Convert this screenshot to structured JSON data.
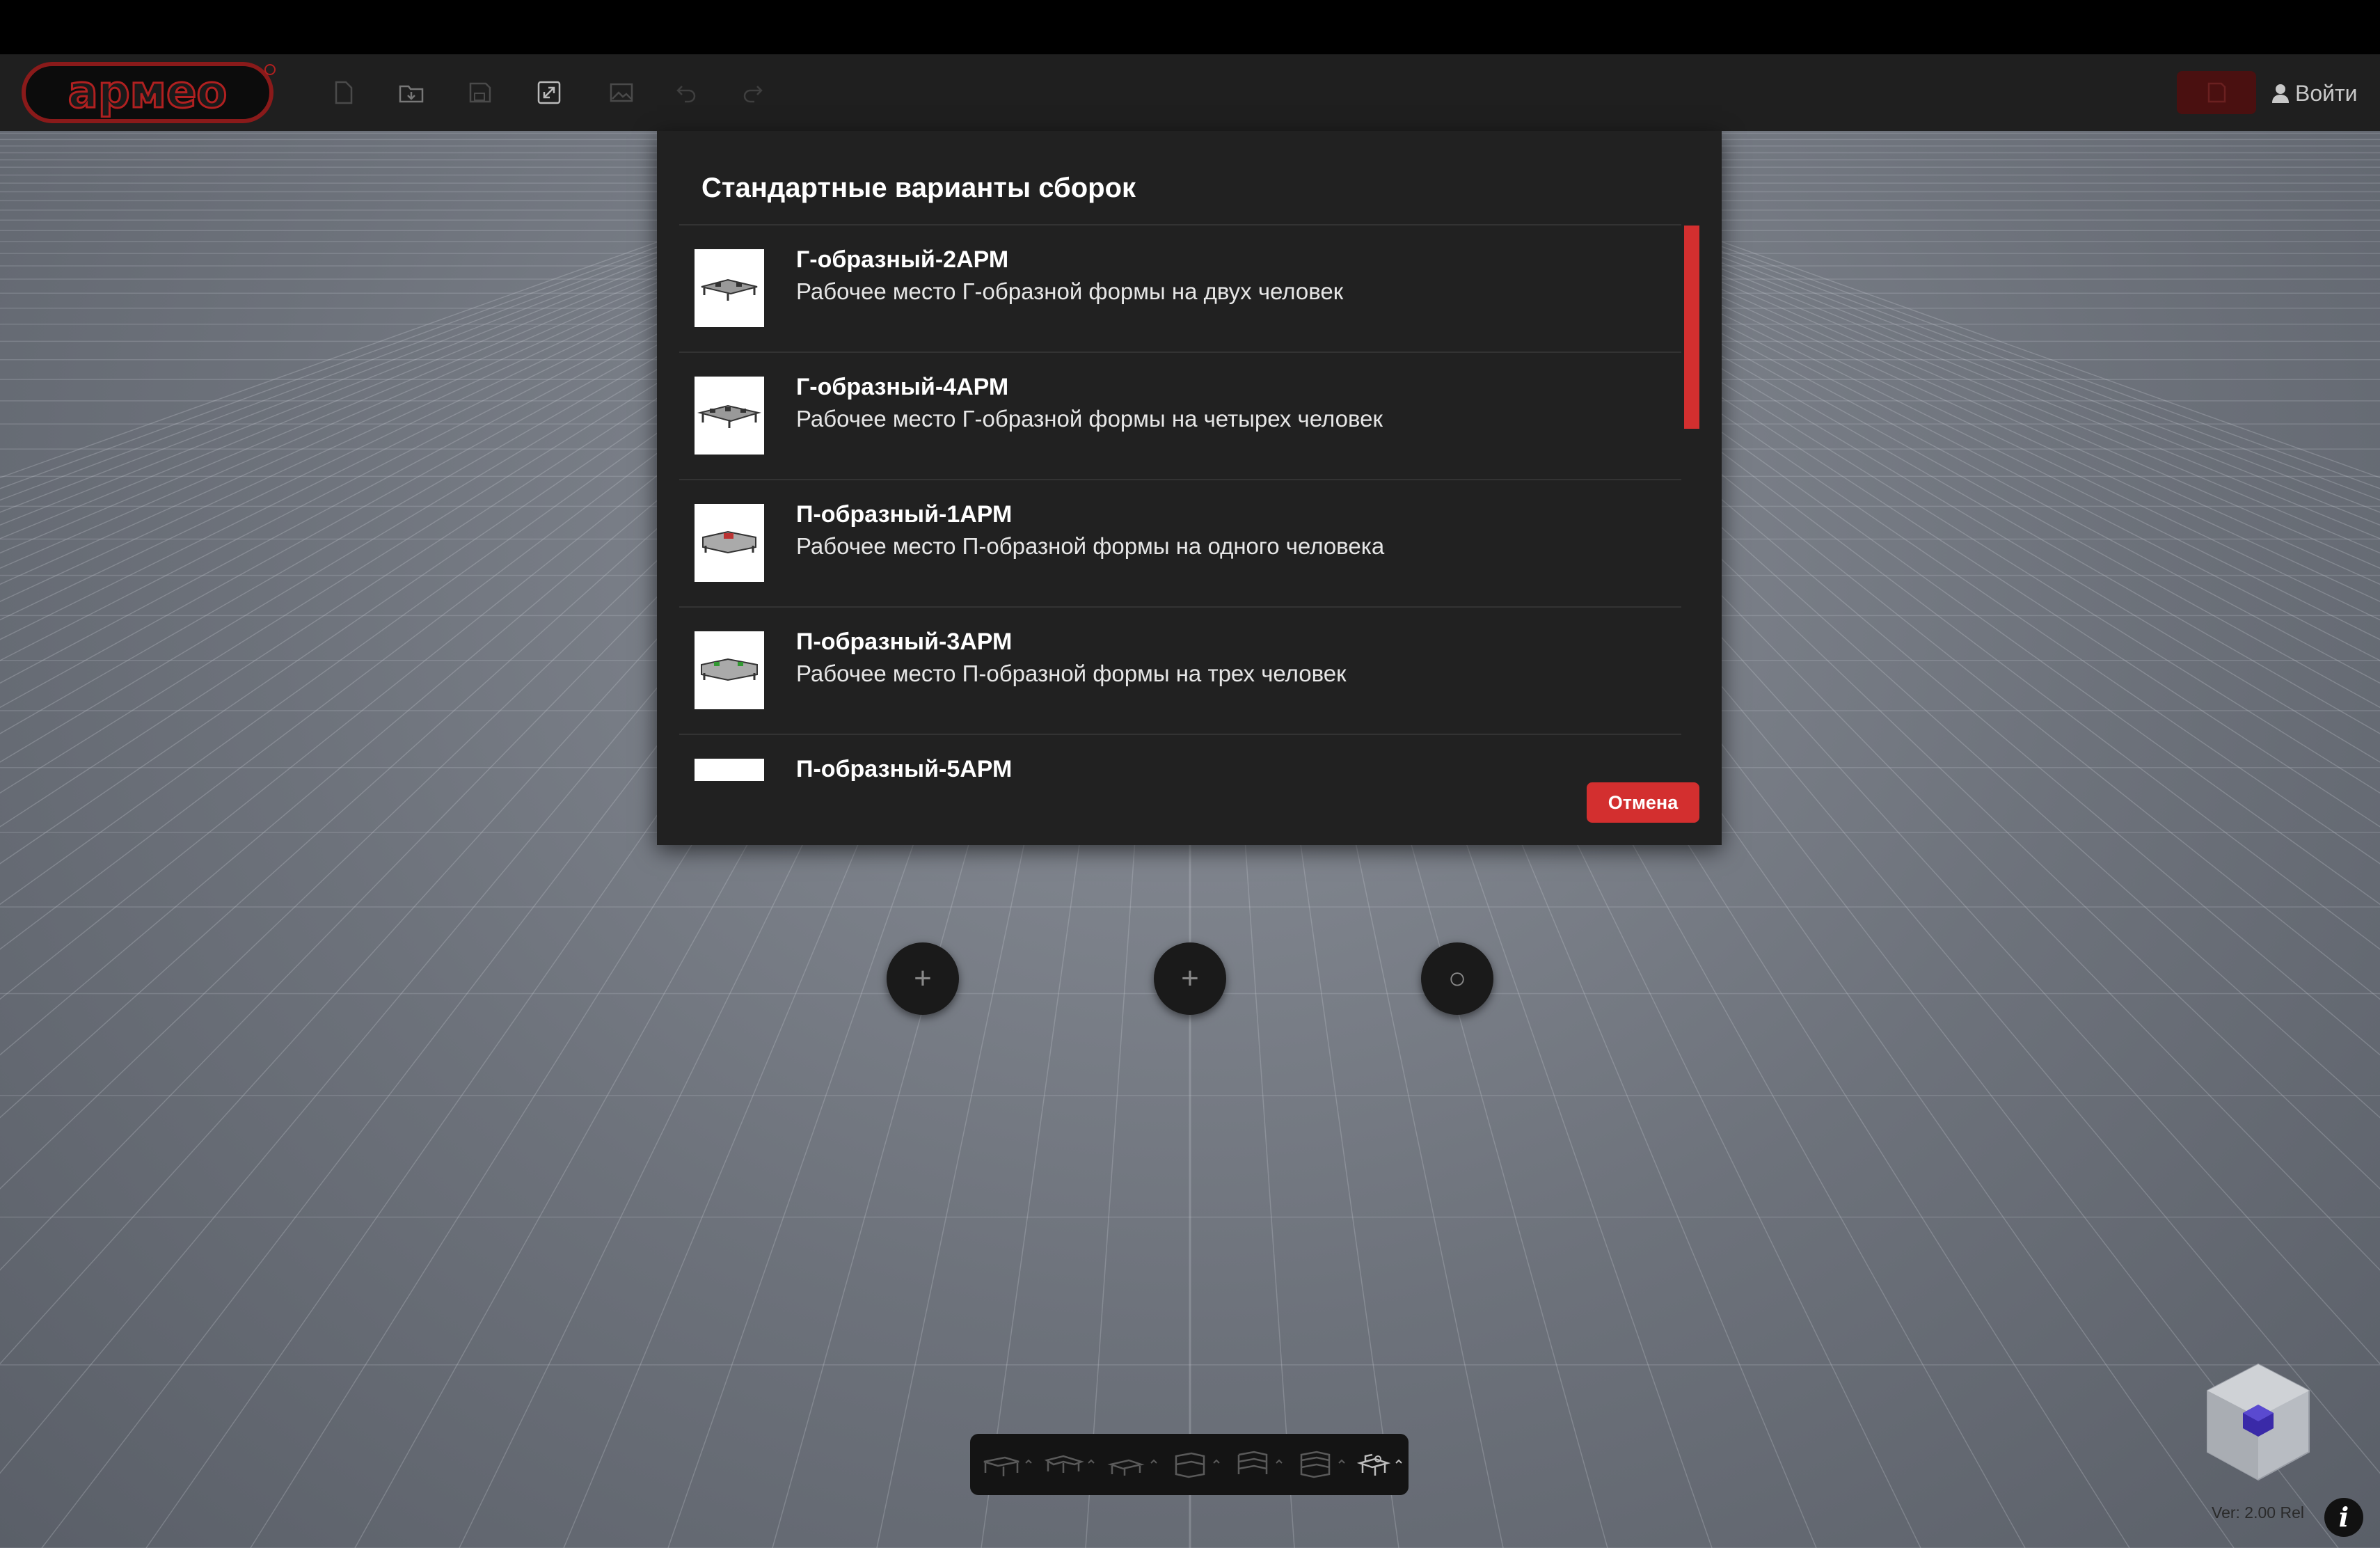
{
  "header": {
    "logo_text": "армео",
    "login_label": "Войти",
    "tool_icons": [
      "new-file-icon",
      "open-folder-icon",
      "save-icon",
      "expand-icon",
      "image-icon",
      "undo-icon",
      "redo-icon"
    ]
  },
  "modal": {
    "title": "Стандартные варианты сборок",
    "items": [
      {
        "name": "Г-образный-2АРМ",
        "description": "Рабочее место Г-образной формы на двух человек"
      },
      {
        "name": "Г-образный-4АРМ",
        "description": "Рабочее место Г-образной формы на четырех человек"
      },
      {
        "name": "П-образный-1АРМ",
        "description": "Рабочее место П-образной формы на одного человека"
      },
      {
        "name": "П-образный-3АРМ",
        "description": "Рабочее место П-образной формы на трех человек"
      },
      {
        "name": "П-образный-5АРМ",
        "description": ""
      }
    ],
    "cancel_label": "Отмена"
  },
  "scene": {
    "fab_icons": [
      "plus-icon",
      "plus-icon",
      "rotate-icon"
    ],
    "fab_glyphs": [
      "+",
      "+",
      "○"
    ],
    "bottom_tools": [
      "desk-icon",
      "desk-corner-icon",
      "desk-small-icon",
      "cabinet-icon",
      "shelf-icon",
      "rack-icon",
      "chair-icon"
    ],
    "version": "Ver: 2.00 Rel",
    "info_glyph": "i"
  },
  "colors": {
    "accent": "#d32f2f",
    "toolbar_bg": "#1f1f1f",
    "modal_bg": "#212121",
    "cube": "#3a2aa8"
  }
}
